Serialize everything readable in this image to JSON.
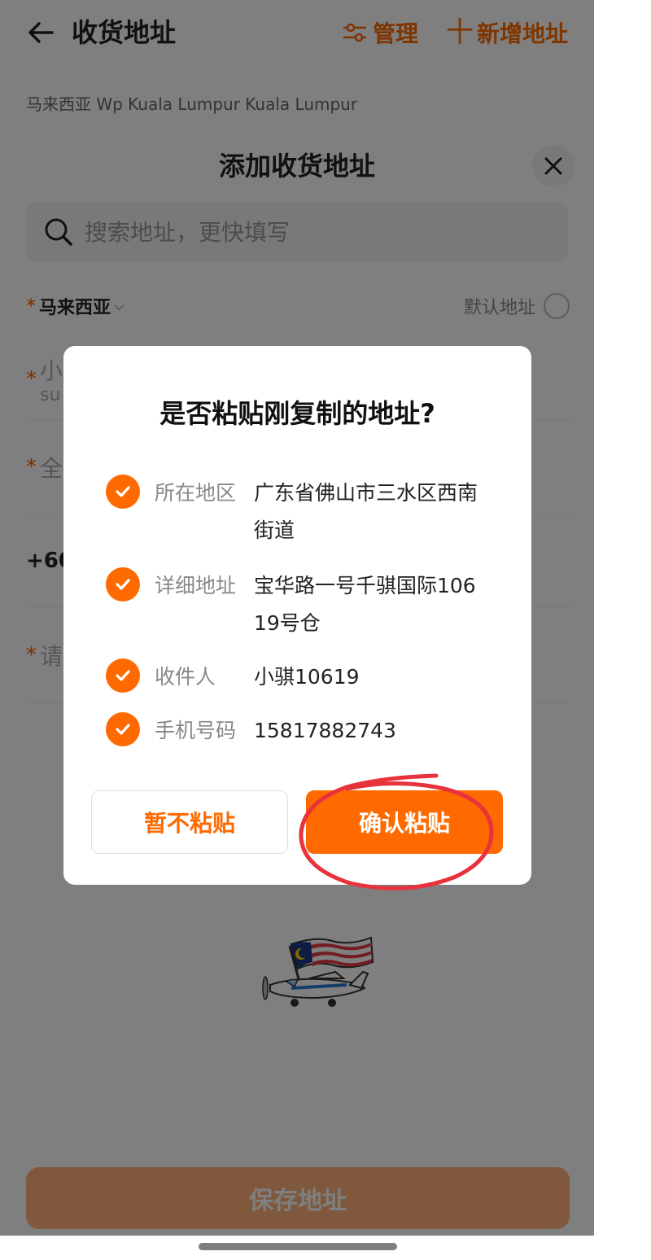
{
  "header": {
    "title": "收货地址",
    "manage_label": "管理",
    "add_label": "新增地址",
    "current_address": "马来西亚 Wp Kuala Lumpur Kuala Lumpur"
  },
  "sheet": {
    "title": "添加收货地址",
    "search_placeholder": "搜索地址，更快填写",
    "required_mark": "*",
    "region_value": "马来西亚",
    "default_label": "默认地址",
    "fields": [
      {
        "visible_text": "小",
        "visible_sub": "su"
      },
      {
        "visible_text": "全"
      },
      {
        "visible_text": "+60"
      },
      {
        "visible_text": "请"
      }
    ],
    "save_label": "保存地址"
  },
  "dialog": {
    "title": "是否粘贴刚复制的地址?",
    "items": [
      {
        "label": "所在地区",
        "value": "广东省佛山市三水区西南街道"
      },
      {
        "label": "详细地址",
        "value": "宝华路一号千骐国际10619号仓"
      },
      {
        "label": "收件人",
        "value": "小骐10619"
      },
      {
        "label": "手机号码",
        "value": "15817882743"
      }
    ],
    "cancel_label": "暂不粘贴",
    "confirm_label": "确认粘贴"
  },
  "colors": {
    "accent": "#ff6a00",
    "annotation": "#e8323c",
    "save_disabled": "#ffb17a"
  },
  "icons": [
    "back-arrow-icon",
    "manage-sliders-icon",
    "plus-icon",
    "close-icon",
    "search-icon",
    "chevron-down-icon",
    "check-icon",
    "plane-flag-illustration"
  ]
}
